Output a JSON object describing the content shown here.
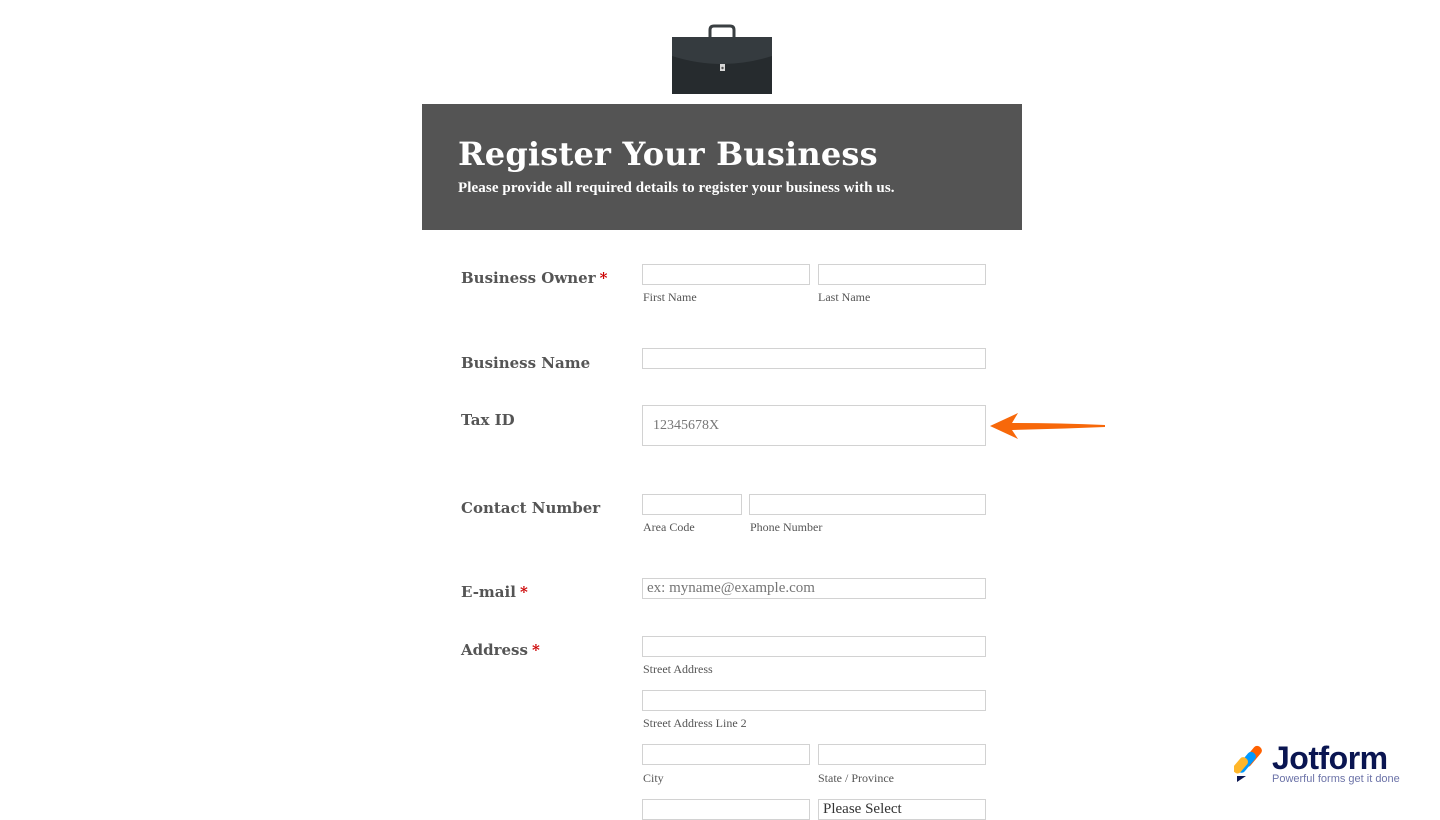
{
  "header": {
    "title": "Register Your Business",
    "subtitle": "Please provide all required details to register your business with us."
  },
  "fields": {
    "business_owner": {
      "label": "Business Owner",
      "required_mark": "*",
      "first_sub": "First Name",
      "last_sub": "Last Name"
    },
    "business_name": {
      "label": "Business Name"
    },
    "tax_id": {
      "label": "Tax ID",
      "value": "12345678X"
    },
    "contact_number": {
      "label": "Contact Number",
      "area_sub": "Area Code",
      "phone_sub": "Phone Number"
    },
    "email": {
      "label": "E-mail",
      "required_mark": "*",
      "placeholder": "ex: myname@example.com"
    },
    "address": {
      "label": "Address",
      "required_mark": "*",
      "street_sub": "Street Address",
      "street2_sub": "Street Address Line 2",
      "city_sub": "City",
      "state_sub": "State / Province",
      "country_value": "Please Select"
    }
  },
  "icons": {
    "logo": "briefcase-icon",
    "pointer": "arrow-left-icon"
  },
  "colors": {
    "header_bg": "#545454",
    "required": "#cc0000",
    "arrow": "#f7680a"
  },
  "brand": {
    "name": "Jotform",
    "tagline": "Powerful forms get it done"
  }
}
